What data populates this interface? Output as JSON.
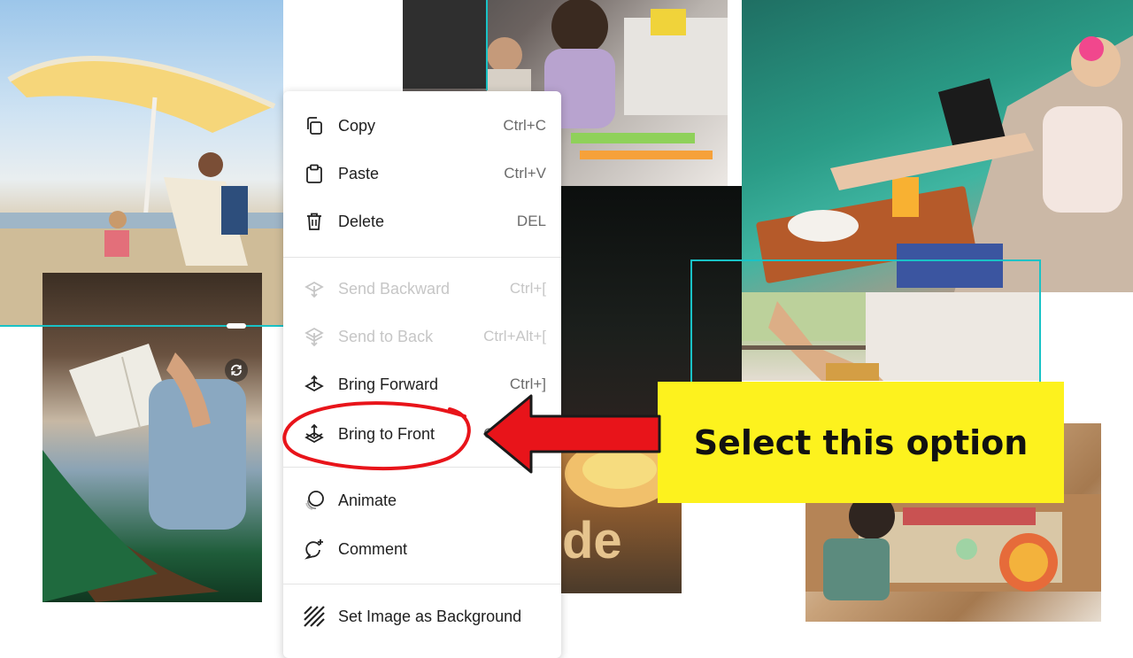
{
  "canvas": {
    "photos": [
      {
        "name": "beach-umbrella-photo"
      },
      {
        "name": "mother-child-photo"
      },
      {
        "name": "poolside-laptop-photo"
      },
      {
        "name": "dark-photo"
      },
      {
        "name": "balcony-legs-photo"
      },
      {
        "name": "pastry-photo"
      },
      {
        "name": "dining-table-photo"
      },
      {
        "name": "hammock-reader-photo"
      }
    ]
  },
  "context_menu": {
    "items": [
      {
        "label": "Copy",
        "shortcut": "Ctrl+C",
        "icon": "copy-icon",
        "enabled": true
      },
      {
        "label": "Paste",
        "shortcut": "Ctrl+V",
        "icon": "paste-icon",
        "enabled": true
      },
      {
        "label": "Delete",
        "shortcut": "DEL",
        "icon": "trash-icon",
        "enabled": true
      },
      {
        "label": "Send Backward",
        "shortcut": "Ctrl+[",
        "icon": "send-backward-icon",
        "enabled": false
      },
      {
        "label": "Send to Back",
        "shortcut": "Ctrl+Alt+[",
        "icon": "send-to-back-icon",
        "enabled": false
      },
      {
        "label": "Bring Forward",
        "shortcut": "Ctrl+]",
        "icon": "bring-forward-icon",
        "enabled": true
      },
      {
        "label": "Bring to Front",
        "shortcut": "Ctrl+Alt+]",
        "icon": "bring-to-front-icon",
        "enabled": true
      },
      {
        "label": "Animate",
        "shortcut": "",
        "icon": "animate-icon",
        "enabled": true
      },
      {
        "label": "Comment",
        "shortcut": "",
        "icon": "comment-plus-icon",
        "enabled": true
      },
      {
        "label": "Set Image as Background",
        "shortcut": "",
        "icon": "background-hatch-icon",
        "enabled": true
      }
    ]
  },
  "annotation": {
    "callout_text": "Select this option",
    "arrow_color": "#e8141a",
    "highlight_circle_color": "#e8141a",
    "callout_color": "#fdf21e"
  },
  "colors": {
    "selection": "#19c2c6",
    "disabled_text": "#c6c6c6"
  }
}
